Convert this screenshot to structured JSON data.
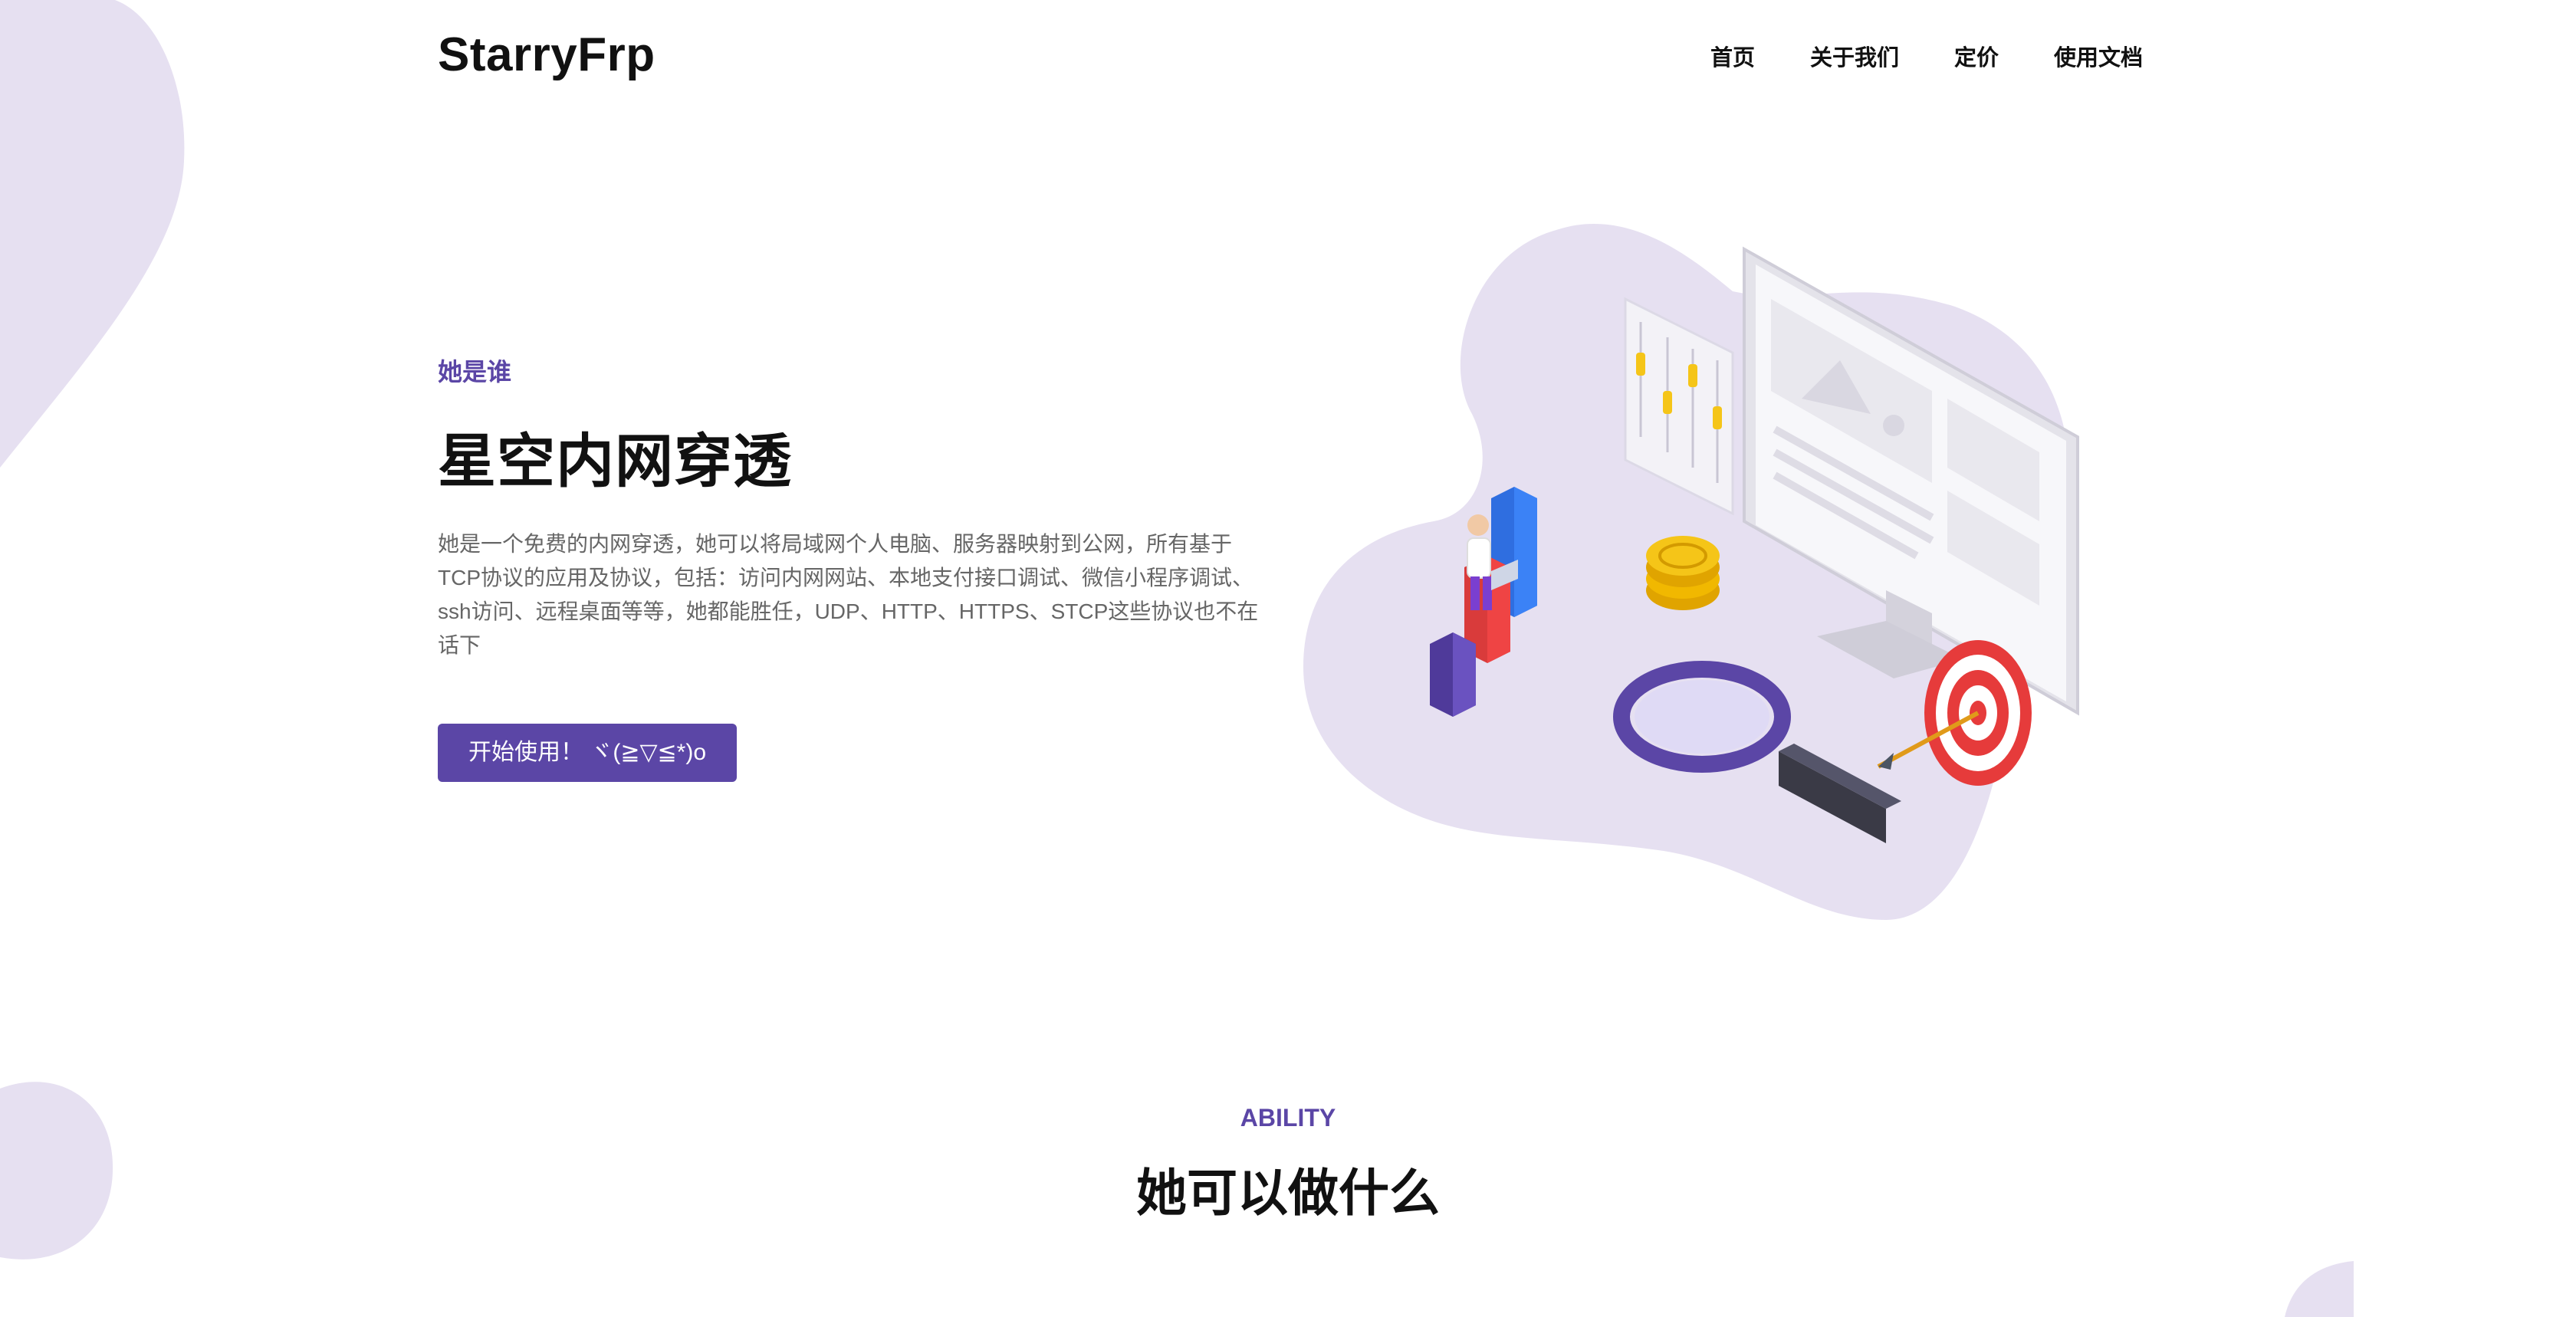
{
  "nav": {
    "logo": "StarryFrp",
    "items": [
      "首页",
      "关于我们",
      "定价",
      "使用文档"
    ]
  },
  "hero": {
    "eyebrow": "她是谁",
    "title": "星空内网穿透",
    "description": "她是一个免费的内网穿透，她可以将局域网个人电脑、服务器映射到公网，所有基于TCP协议的应用及协议，包括：访问内网网站、本地支付接口调试、微信小程序调试、ssh访问、远程桌面等等，她都能胜任，UDP、HTTP、HTTPS、STCP这些协议也不在话下",
    "cta_label": "开始使用！ ヾ(≧▽≦*)o"
  },
  "ability": {
    "tag": "ABILITY",
    "title": "她可以做什么"
  },
  "colors": {
    "accent": "#5b46a6",
    "blob": "#e6e0f1",
    "text": "#111111",
    "muted": "#666666"
  },
  "icons": [
    "hero-illustration"
  ]
}
